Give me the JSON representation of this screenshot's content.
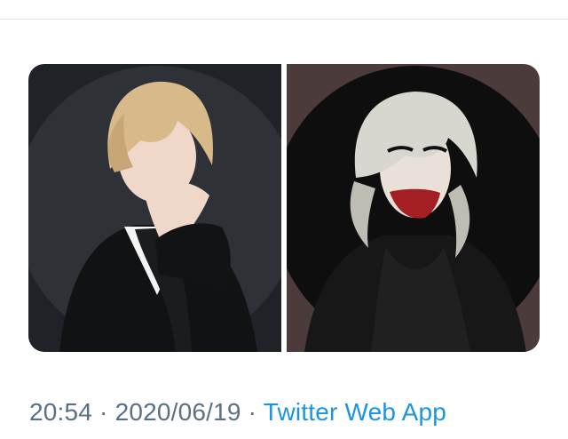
{
  "tweet": {
    "time": "20:54",
    "separator": " · ",
    "date": "2020/06/19",
    "source": "Twitter Web App"
  },
  "media": {
    "images": [
      {
        "name": "profile-photo-blonde-leather-jacket",
        "background": "#1f2328",
        "circle": "#2e3237",
        "hair": "#d8b98a",
        "skin": "#efd7c9",
        "jacket": "#101214",
        "shirt": "#f3f3f3"
      },
      {
        "name": "profile-photo-platinum-red-lips",
        "background": "#4b3b3b",
        "circle": "#0e0e0f",
        "hair": "#d7d6cf",
        "skin": "#e9e1d7",
        "jacket": "#171717",
        "lips": "#a31f24"
      }
    ]
  },
  "colors": {
    "text_muted": "#5b7083",
    "link": "#1b95e0",
    "divider": "#e3e6e8"
  }
}
